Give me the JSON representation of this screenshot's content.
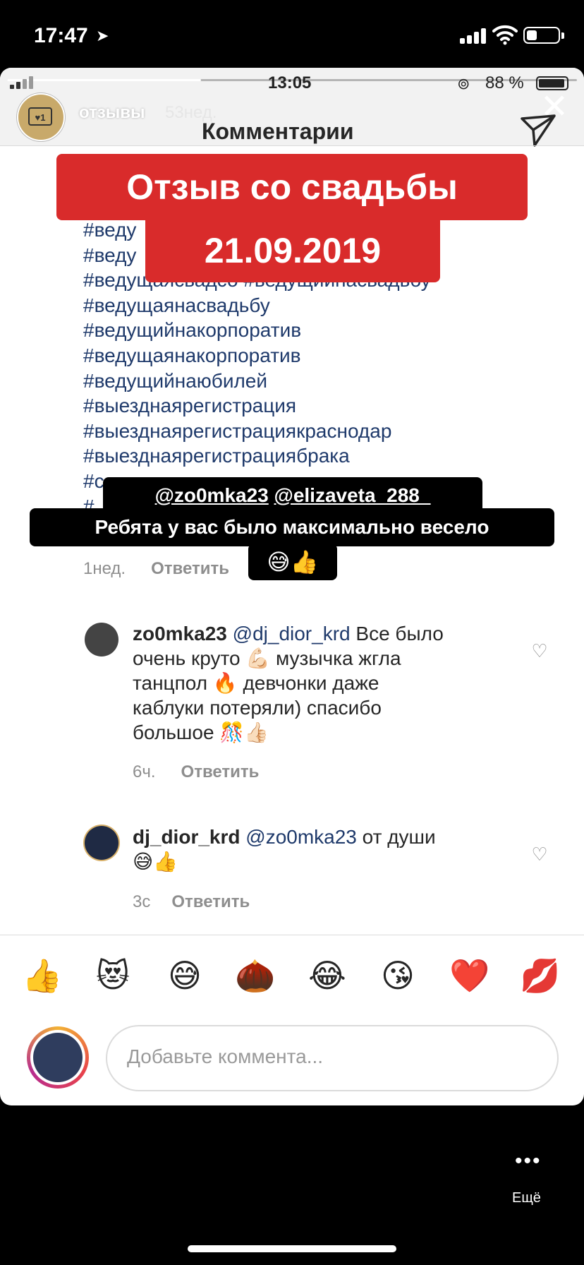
{
  "os_status": {
    "time": "17:47",
    "arrow": "➤"
  },
  "story": {
    "progress": 0.34,
    "inner_status": {
      "time": "13:05",
      "battery": "88 %"
    },
    "username": "отзывы",
    "age": "53нед.",
    "header_title": "Комментарии",
    "close_icon": "close-icon",
    "send_icon": "send-icon"
  },
  "banner": {
    "line1": "Отзыв со свадьбы",
    "line2": "21.09.2019",
    "color": "#d92b2b"
  },
  "hashtags": [
    "#веду",
    "#веду",
    "#ведущаясвадсо #ведущийнасвадьбу",
    "#ведущаянасвадьбу",
    "#ведущийнакорпоратив",
    "#ведущаянакорпоратив",
    "#ведущийнаюбилей",
    "#выезднаярегистрация",
    "#выезднаярегистрациякраснодар",
    "#выезднаярегистрациябрака",
    "#с",
    "#"
  ],
  "sticker": {
    "mention1": "@zo0mka23",
    "mention2": "@elizaveta_288_",
    "text": "Ребята у вас было максимально весело",
    "emojis": "😅👍"
  },
  "first_meta": {
    "time": "1нед.",
    "reply": "Ответить"
  },
  "comments": [
    {
      "user": "zo0mka23",
      "mention": "@dj_dior_krd",
      "line1_rest": " Все было",
      "line2": "очень круто 💪🏻 музычка жгла",
      "line3": "танцпол 🔥 девчонки даже",
      "line4": "каблуки потеряли) спасибо",
      "line5": "большое 🎊👍🏻",
      "time": "6ч.",
      "reply": "Ответить"
    },
    {
      "user": "dj_dior_krd",
      "mention": "@zo0mka23",
      "line1_rest": " от души",
      "line2": "😅👍",
      "time": "3с",
      "reply": "Ответить"
    }
  ],
  "quick_emojis": [
    "👍",
    "😻",
    "😅",
    "🌰",
    "😂",
    "😘",
    "❤️",
    "💋"
  ],
  "composer": {
    "placeholder": "Добавьте коммента..."
  },
  "more": {
    "dots": "•••",
    "label": "Ещё"
  }
}
